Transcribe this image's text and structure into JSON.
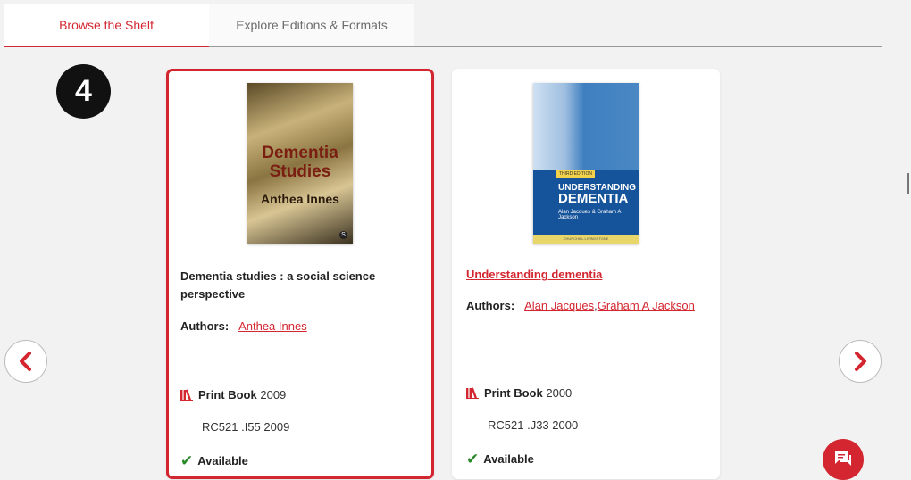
{
  "tabs": {
    "browse": "Browse the Shelf",
    "explore": "Explore Editions & Formats"
  },
  "step_number": "4",
  "books": [
    {
      "cover_title": "Dementia Studies",
      "cover_author": "Anthea Innes",
      "title": "Dementia studies : a social science perspective",
      "authors_label": "Authors:",
      "authors": [
        "Anthea Innes"
      ],
      "format": "Print Book",
      "year": "2009",
      "call_number": "RC521 .I55 2009",
      "availability": "Available"
    },
    {
      "cover_edition": "THIRD EDITION",
      "cover_title_line1": "UNDERSTANDING",
      "cover_title_line2": "DEMENTIA",
      "cover_author": "Alan Jacques & Graham A Jackson",
      "cover_publisher": "CHURCHILL LIVINGSTONE",
      "title": "Understanding dementia",
      "authors_label": "Authors:",
      "authors": [
        "Alan Jacques",
        "Graham A Jackson"
      ],
      "format": "Print Book",
      "year": "2000",
      "call_number": "RC521 .J33 2000",
      "availability": "Available"
    }
  ],
  "nav": {
    "prev_icon": "chevron-left-icon",
    "next_icon": "chevron-right-icon"
  },
  "colors": {
    "accent": "#d32630",
    "available": "#2a8a2a"
  }
}
